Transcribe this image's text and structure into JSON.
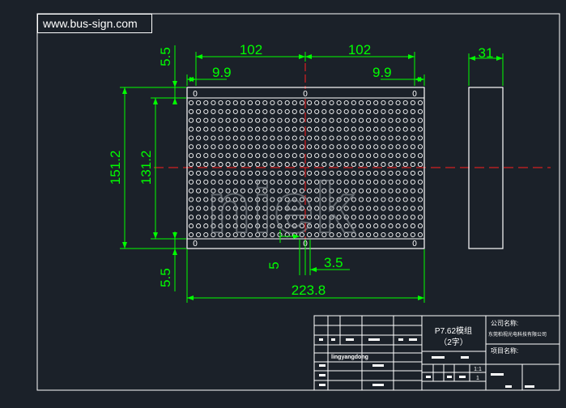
{
  "header": {
    "website": "www.bus-sign.com"
  },
  "drawing": {
    "dimensions": {
      "width_left_half": "102",
      "width_right_half": "102",
      "offset_left": "9.9",
      "offset_right": "9.9",
      "top_margin": "5.5",
      "bottom_margin": "5.5",
      "outer_height": "151.2",
      "inner_height": "131.2",
      "hole_offset": "5",
      "hole_spacing": "3.5",
      "total_width": "223.8",
      "depth": "31"
    },
    "mounting_hole_label": "0",
    "watermark": "niek"
  },
  "title_block": {
    "model": "P7.62模组",
    "model_sub": "（2字）",
    "company_label": "公司名称:",
    "company_name": "东莞柏视光电科技有限公司",
    "project_label": "项目名称:",
    "drawer": "lingyangdong",
    "scale": "1:1",
    "sheet": "1"
  },
  "colors": {
    "background": "#1b2129",
    "dimension": "#00ff00",
    "outline": "#ffffff",
    "centerline": "#ff0000"
  }
}
